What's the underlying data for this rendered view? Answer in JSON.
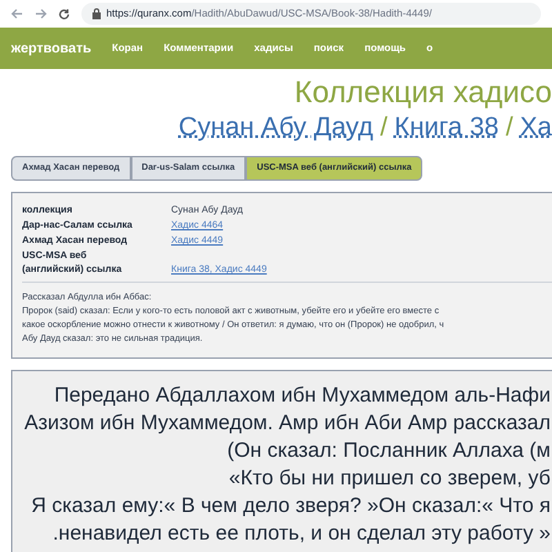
{
  "browser": {
    "url_host": "https://quranx.com",
    "url_path": "/Hadith/AbuDawud/USC-MSA/Book-38/Hadith-4449/"
  },
  "nav": {
    "donate": "жертвовать",
    "items": [
      "Коран",
      "Комментарии",
      "хадисы",
      "поиск",
      "помощь",
      "о"
    ]
  },
  "title": "Коллекция хадисо",
  "breadcrumb": [
    {
      "text": "Сунан Абу Дауд",
      "kind": "link"
    },
    {
      "text": "/",
      "kind": "sep"
    },
    {
      "text": "Книга 38",
      "kind": "link"
    },
    {
      "text": "/",
      "kind": "sep"
    },
    {
      "text": "Ха",
      "kind": "link"
    }
  ],
  "tabs": [
    {
      "label": "Ахмад Хасан перевод",
      "selected": false
    },
    {
      "label": "Dar-us-Salam ссылка",
      "selected": false
    },
    {
      "label": "USC-MSA веб (английский) ссылка",
      "selected": true
    }
  ],
  "info": [
    {
      "label": "коллекция",
      "value": "Сунан Абу Дауд",
      "kind": "text"
    },
    {
      "label": "Дар-нас-Салам ссылка",
      "value": "Хадис 4464",
      "kind": "link"
    },
    {
      "label": "Ахмад Хасан перевод",
      "value": "Хадис 4449",
      "kind": "link"
    },
    {
      "label": "USC-MSA веб (английский) ссылка",
      "value": "Книга 38, Хадис 4449",
      "kind": "link"
    }
  ],
  "narration": [
    "Рассказал Абдулла ибн Аббас:",
    "Пророк (said) сказал: Если у кого-то есть половой акт с животным, убейте его и убейте его вместе с",
    "какое оскорбление можно отнести к животному / Он ответил: я думаю, что он (Пророк) не одобрил, ч",
    "Абу Дауд сказал: это не сильная традиция."
  ],
  "translation": [
    "Передано Абдаллахом ибн Мухаммедом аль-Нафи",
    "Азизом ибн Мухаммедом. Амр ибн Аби Амр рассказал",
    "(Он сказал: Посланник Аллаха (м",
    "«Кто бы ни пришел со зверем, уб",
    "Я сказал ему:« В чем дело зверя? »Он сказал:« Что я",
    ".ненавидел есть ее плоть, и он сделал эту работу »"
  ]
}
